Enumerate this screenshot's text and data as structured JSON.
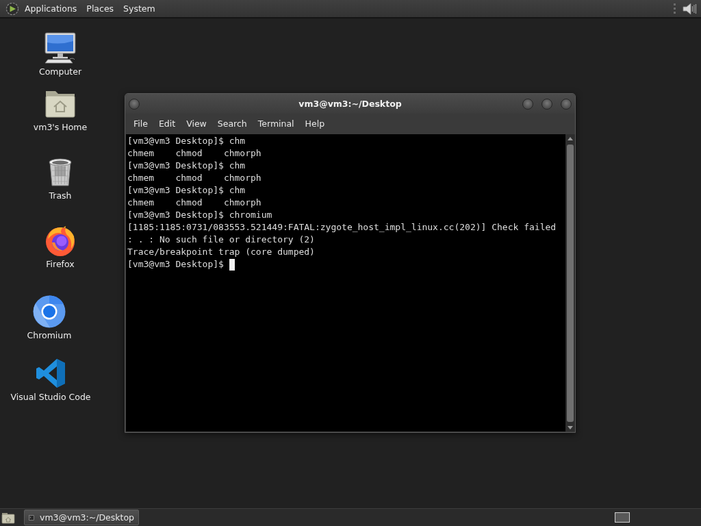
{
  "top_panel": {
    "menus": [
      "Applications",
      "Places",
      "System"
    ]
  },
  "desktop_icons": [
    {
      "label": "Computer",
      "kind": "computer"
    },
    {
      "label": "vm3's Home",
      "kind": "home"
    },
    {
      "label": "Trash",
      "kind": "trash"
    },
    {
      "label": "Firefox",
      "kind": "flame-globe"
    },
    {
      "label": "Chromium",
      "kind": "ring-globe"
    },
    {
      "label": "Visual Studio Code",
      "kind": "code-editor"
    }
  ],
  "terminal_window": {
    "title": "vm3@vm3:~/Desktop",
    "menu": [
      "File",
      "Edit",
      "View",
      "Search",
      "Terminal",
      "Help"
    ],
    "lines": [
      "[vm3@vm3 Desktop]$ chm",
      "chmem    chmod    chmorph",
      "[vm3@vm3 Desktop]$ chm",
      "chmem    chmod    chmorph",
      "[vm3@vm3 Desktop]$ chm",
      "chmem    chmod    chmorph",
      "[vm3@vm3 Desktop]$ chromium",
      "[1185:1185:0731/083553.521449:FATAL:zygote_host_impl_linux.cc(202)] Check failed",
      ": . : No such file or directory (2)",
      "Trace/breakpoint trap (core dumped)",
      "[vm3@vm3 Desktop]$"
    ],
    "cursor": true
  },
  "taskbar": {
    "tasks": [
      {
        "label": "vm3@vm3:~/Desktop",
        "selected": true
      }
    ]
  }
}
